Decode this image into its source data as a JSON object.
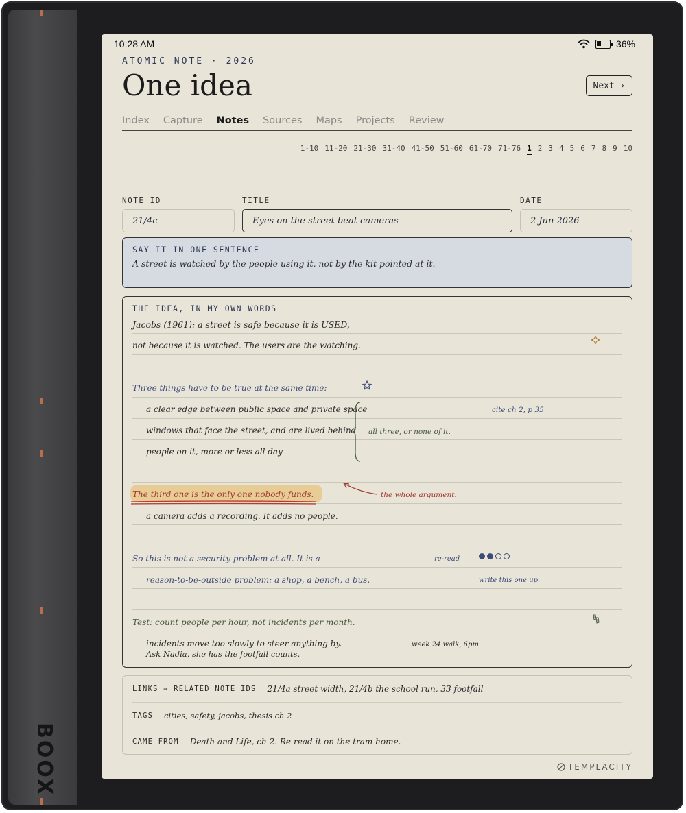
{
  "device": {
    "brand": "BOOX"
  },
  "status": {
    "time": "10:28 AM",
    "battery": "36%"
  },
  "header": {
    "eyebrow": "ATOMIC NOTE · 2026",
    "title": "One idea",
    "next_label": "Next ›"
  },
  "tabs": [
    {
      "label": "Index",
      "active": false
    },
    {
      "label": "Capture",
      "active": false
    },
    {
      "label": "Notes",
      "active": true
    },
    {
      "label": "Sources",
      "active": false
    },
    {
      "label": "Maps",
      "active": false
    },
    {
      "label": "Projects",
      "active": false
    },
    {
      "label": "Review",
      "active": false
    }
  ],
  "pager": [
    "1-10",
    "11-20",
    "21-30",
    "31-40",
    "41-50",
    "51-60",
    "61-70",
    "71-76",
    "1",
    "2",
    "3",
    "4",
    "5",
    "6",
    "7",
    "8",
    "9",
    "10"
  ],
  "pager_current": "1",
  "fields": {
    "note_id_label": "NOTE ID",
    "note_id": "21/4c",
    "title_label": "TITLE",
    "title": "Eyes on the street beat cameras",
    "date_label": "DATE",
    "date": "2 Jun 2026"
  },
  "sentence": {
    "label": "SAY IT IN ONE SENTENCE",
    "text": "A street is watched by the people using it, not by the kit pointed at it."
  },
  "ideas": {
    "label": "THE IDEA, IN MY OWN WORDS",
    "line1": "Jacobs (1961): a street is safe because it is USED,",
    "line2": "not because it is watched. The users are the watching.",
    "line3": "Three things have to be true at the same time:",
    "item1": "a clear edge between public space and private space",
    "item2": "windows that face the street, and are lived behind",
    "item3": "people on it, more or less all day",
    "cite": "cite ch 2, p 35",
    "brace_note": "all three, or none of it.",
    "highlight": "The third one is the only one nobody funds.",
    "arrow_note": "the whole argument.",
    "line4": "a camera adds a recording. It adds no people.",
    "line5": "So this is not a security problem at all. It is a",
    "reread": "re-read",
    "line6": "reason-to-be-outside problem: a shop, a bench, a bus.",
    "write_up": "write this one up.",
    "line7": "Test: count people per hour, not incidents per month.",
    "line8": "incidents move too slowly to steer anything by.",
    "walk_note": "week 24 walk, 6pm.",
    "line9": "Ask Nadia, she has the footfall counts.",
    "reread_progress": "2/4"
  },
  "links": {
    "links_label": "LINKS → RELATED NOTE IDS",
    "links_value": "21/4a street width, 21/4b the school run, 33 footfall",
    "tags_label": "TAGS",
    "tags_value": "cities, safety, jacobs, thesis ch 2",
    "from_label": "CAME FROM",
    "from_value": "Death and Life, ch 2. Re-read it on the tram home."
  },
  "footer": {
    "brand": "TEMPLACITY"
  }
}
